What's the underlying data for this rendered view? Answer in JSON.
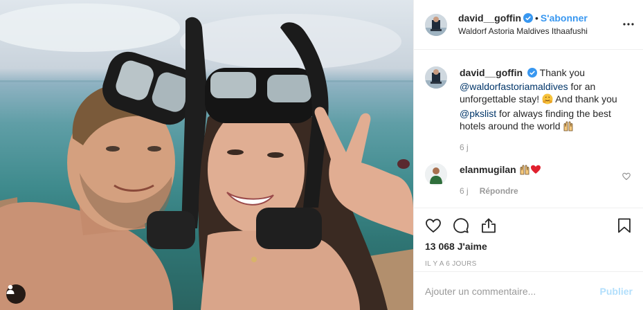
{
  "header": {
    "username": "david__goffin",
    "dot": "•",
    "follow_label": "S'abonner",
    "location": "Waldorf Astoria Maldives Ithaafushi"
  },
  "caption": {
    "username": "david__goffin",
    "text_1": "Thank you ",
    "mention_1": "@waldorfastoriamaldives",
    "text_2": " for an unforgettable stay! ",
    "text_3": " And thank you ",
    "mention_2": "@pkslist",
    "text_4": " for always finding the best hotels around the world ",
    "time": "6 j"
  },
  "comment": {
    "username": "elanmugilan",
    "time": "6 j",
    "reply_label": "Répondre"
  },
  "stats": {
    "likes": "13 068 J'aime",
    "posted_ago": "Il y a 6 jours"
  },
  "composer": {
    "placeholder": "Ajouter un commentaire...",
    "publish_label": "Publier"
  },
  "colors": {
    "accent": "#3897f0",
    "verified": "#3897f0",
    "mention": "#003569",
    "muted": "#999999",
    "publish_disabled": "#b2dffc",
    "heart_red": "#ed4956"
  },
  "icons": {
    "like": "heart-icon",
    "comment": "comment-icon",
    "share": "share-icon",
    "save": "bookmark-icon",
    "more": "more-options-icon",
    "tag": "user-tag-icon"
  }
}
